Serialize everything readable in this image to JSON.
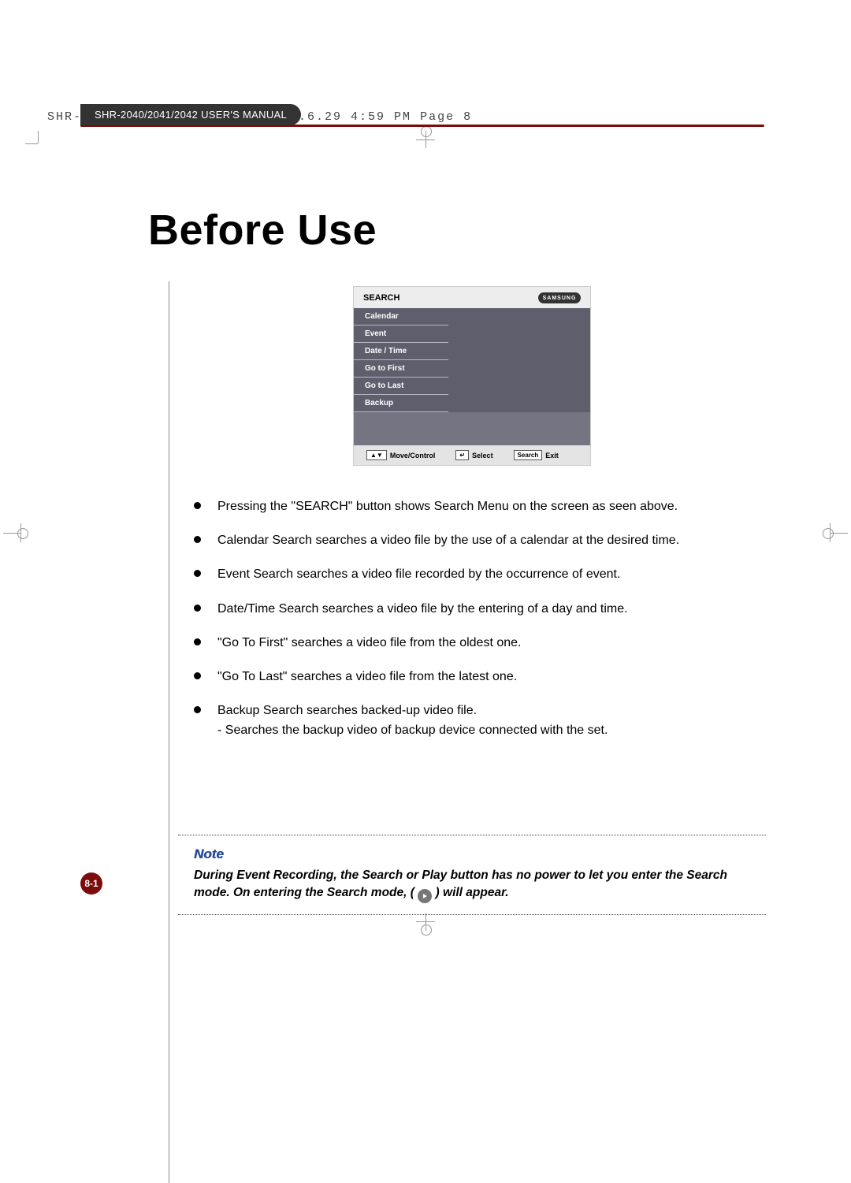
{
  "printer_slug": "SHR-2040/2041/2042-ENG-1  2005.6.29  4:59 PM  Page 8",
  "header_label": "SHR-2040/2041/2042 USER'S MANUAL",
  "heading": "Before Use",
  "screenshot": {
    "title": "SEARCH",
    "brand": "SAMSUNG",
    "menu": [
      "Calendar",
      "Event",
      "Date / Time",
      "Go to First",
      "Go to Last",
      "Backup"
    ],
    "footer": {
      "move": "Move/Control",
      "select": "Select",
      "exit_key": "Search",
      "exit": "Exit"
    }
  },
  "bullets": [
    {
      "text": "Pressing the \"SEARCH\" button shows Search Menu on the screen as seen above."
    },
    {
      "text": "Calendar Search searches a video file by the use of a calendar at the desired time."
    },
    {
      "text": "Event Search searches a video file recorded by the occurrence of event."
    },
    {
      "text": "Date/Time Search searches a video file by the entering of a day and time."
    },
    {
      "text": "\"Go To First\" searches a video file from the oldest one."
    },
    {
      "text": "\"Go To Last\" searches a video file from the latest one."
    },
    {
      "text": "Backup Search searches backed-up video file.",
      "sub": "- Searches the backup video of backup device connected with the set."
    }
  ],
  "note": {
    "title": "Note",
    "line1": "During Event Recording, the Search or Play button has no power to let you enter the Search mode. On entering the Search mode, (",
    "line2": ") will appear."
  },
  "page_number": "8-1"
}
